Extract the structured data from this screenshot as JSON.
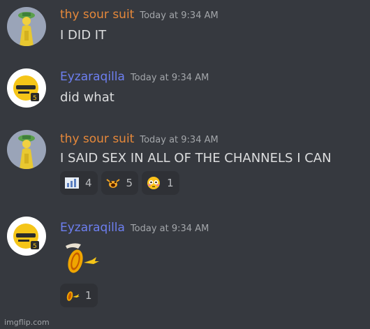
{
  "colors": {
    "background": "#36393f",
    "user1_name": "#e6883a",
    "user2_name": "#6d7ff0",
    "reaction_bg": "#2f3136"
  },
  "messages": [
    {
      "username": "thy sour suit",
      "timestamp": "Today at 9:34 AM",
      "text": "I DID IT",
      "avatar": "green-hat-figure-avatar"
    },
    {
      "username": "Eyzaraqilla",
      "timestamp": "Today at 9:34 AM",
      "text": "did what",
      "avatar": "sunglasses-emoji-avatar"
    },
    {
      "username": "thy sour suit",
      "timestamp": "Today at 9:34 AM",
      "text": "I SAID SEX IN ALL OF THE CHANNELS I CAN",
      "avatar": "green-hat-figure-avatar",
      "reactions": [
        {
          "emoji": "chart-emoji",
          "count": "4"
        },
        {
          "emoji": "shouting-face-emoji",
          "count": "5"
        },
        {
          "emoji": "flushed-face-emoji",
          "count": "1"
        }
      ]
    },
    {
      "username": "Eyzaraqilla",
      "timestamp": "Today at 9:34 AM",
      "emoji": "banana-emoji",
      "avatar": "sunglasses-emoji-avatar",
      "reactions": [
        {
          "emoji": "banana-emoji",
          "count": "1"
        }
      ]
    }
  ],
  "watermark": "imgflip.com"
}
